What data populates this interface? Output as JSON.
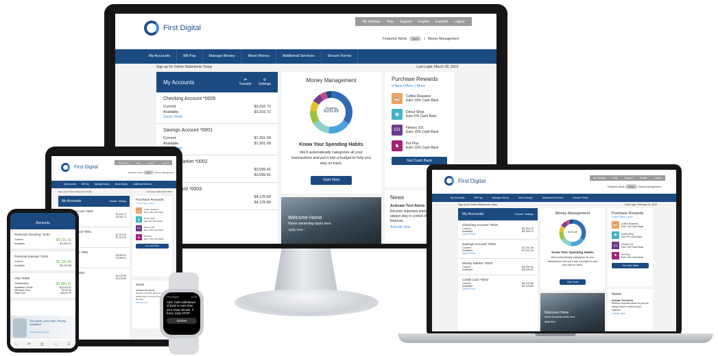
{
  "brand": {
    "name": "First Digital",
    "color": "#1a4a80",
    "accent": "#3a8fd3"
  },
  "utility": [
    "My Settings",
    "Help",
    "Support",
    "English",
    "Español",
    "Logout"
  ],
  "featured": {
    "label": "Featured: Alerts",
    "badge": "New!",
    "money": "Money Management"
  },
  "nav": [
    "My Accounts",
    "Bill Pay",
    "Manage Money",
    "Move Money",
    "Additional Services",
    "Secure Forms"
  ],
  "sub": {
    "left": "Sign up for Online Statements Today",
    "right": "Last Login: March 28, 2019"
  },
  "accounts": {
    "title": "My Accounts",
    "transfer": "Transfer",
    "settings": "Settings",
    "current": "Current",
    "available": "Available",
    "quick": "Quick Peek",
    "items": [
      {
        "name": "Checking Account *0026",
        "current": "$3,316.72",
        "available": "$3,316.72"
      },
      {
        "name": "Savings Account *0001",
        "current": "$7,201.09",
        "available": "$7,201.09"
      },
      {
        "name": "Money Market *0002",
        "current": "$3,099.41",
        "available": "$3,099.41"
      },
      {
        "name": "Credit Card *0003",
        "current": "$4,125.89",
        "available": "$4,125.89"
      }
    ]
  },
  "money": {
    "title": "Money Management",
    "center": "$203.89",
    "center_label": "Shopping",
    "heading": "Know Your Spending Habits",
    "body": "We'll automatically categorize all your transactions and put it into a budget to help you stay on track.",
    "button": "Start Now",
    "donut": [
      {
        "v": 0.34,
        "c": "#2f6cb3"
      },
      {
        "v": 0.18,
        "c": "#4aa3df"
      },
      {
        "v": 0.14,
        "c": "#8dd0c6"
      },
      {
        "v": 0.1,
        "c": "#9ac43d"
      },
      {
        "v": 0.08,
        "c": "#e0c22c"
      },
      {
        "v": 0.07,
        "c": "#7c3a8e"
      },
      {
        "v": 0.05,
        "c": "#c54a8a"
      },
      {
        "v": 0.04,
        "c": "#1a4a80"
      }
    ]
  },
  "rewards": {
    "title": "Purchase Rewards",
    "new": "4 New Offers",
    "more": "More",
    "button": "Get Cash Back",
    "items": [
      {
        "name": "Coffee Roasters",
        "offer": "Earn 10% Cash Back",
        "color": "#f0a35b",
        "icon": "☕"
      },
      {
        "name": "Donut Shop",
        "offer": "Earn 5% Cash Back",
        "color": "#3fb5c4",
        "icon": "◉"
      },
      {
        "name": "Fitness 101",
        "offer": "Earn 15% Cash Back",
        "color": "#6b3b8e",
        "icon": "101"
      },
      {
        "name": "Pet Plus",
        "offer": "Earn 10% Cash Back",
        "color": "#a4227a",
        "icon": "♞"
      }
    ]
  },
  "welcome": {
    "title": "Welcome Home",
    "body": "Home ownership starts here.",
    "link": "Apply Now ›"
  },
  "news": {
    "title": "News",
    "alert": "Activate Text Alerts",
    "body": "Receive important alerts so you can always stay in control of your finances.",
    "link": "Activate Now"
  },
  "laptop": {
    "last": "Last Login: February 14, 2019",
    "alert": "Activate Text Alerts."
  },
  "phone": {
    "title": "Accounts",
    "items": [
      {
        "name": "Personal Checking *1234",
        "r1": "Current",
        "v1": "$4,231.41",
        "r2": "Available",
        "v2": "$4,060.41"
      },
      {
        "name": "Personal Savings *1234",
        "r1": "Current",
        "v1": "$5,120.56",
        "r2": "Available",
        "v2": "$5,120.56"
      },
      {
        "name": "Visa *0098",
        "r1": "Outstanding",
        "v1": "$2,984.21",
        "r2": "Available Credit",
        "v2": "$1,016.21"
      }
    ],
    "min": "Minimum Due",
    "min_v": "$139.00",
    "due": "Date Due",
    "due_v": "March 29",
    "promo": "One place, your pace. Bill pay, simplified.",
    "promo_link": "Activate bill pay today"
  },
  "watch": {
    "app": "First Digital",
    "time": "10:09",
    "msg": "Alert: Cash withdrawal of $100 is more than your usual amount. If fraud, reply STOP.",
    "dismiss": "Dismiss"
  }
}
